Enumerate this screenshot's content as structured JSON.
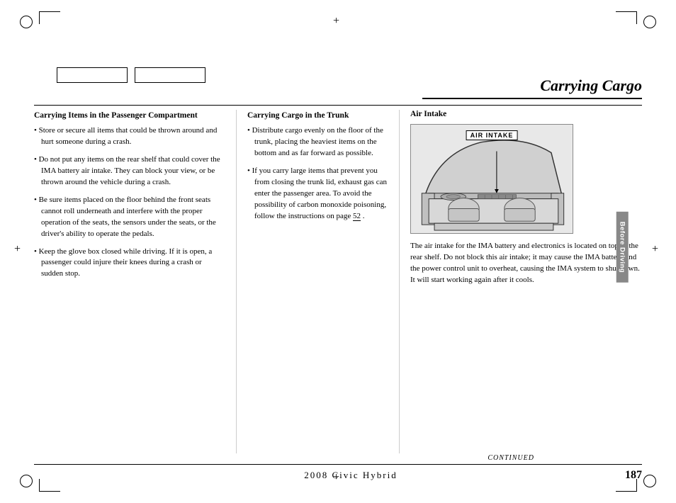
{
  "page": {
    "title": "Carrying Cargo",
    "footer_vehicle": "2008  Civic  Hybrid",
    "page_number": "187",
    "continued": "CONTINUED",
    "sidebar_label": "Before Driving"
  },
  "left_column": {
    "section_title": "Carrying Items in the Passenger Compartment",
    "bullets": [
      "Store or secure all items that could be thrown around and hurt someone during a crash.",
      "Do not put any items on the rear shelf that could cover the IMA battery air intake. They can block your view, or be thrown around the vehicle during a crash.",
      "Be sure items placed on the floor behind the front seats cannot roll underneath and interfere with the proper operation of the seats, the sensors under the seats, or the driver's ability to operate the pedals.",
      "Keep the glove box closed while driving. If it is open, a passenger could injure their knees during a crash or sudden stop."
    ]
  },
  "middle_column": {
    "section_title": "Carrying Cargo in the Trunk",
    "bullets": [
      "Distribute cargo evenly on the floor of the trunk, placing the heaviest items on the bottom and as far forward as possible.",
      "If you carry large items that prevent you from closing the trunk lid, exhaust gas can enter the passenger area. To avoid the possibility of carbon monoxide poisoning, follow the instructions on page 52 ."
    ],
    "page_link": "52"
  },
  "right_column": {
    "section_title": "Air Intake",
    "diagram_label": "AIR INTAKE",
    "description": "The air intake for the IMA battery and electronics is located on top of the rear shelf. Do not block this air intake; it may cause the IMA battery and the power control unit to overheat, causing the IMA system to shut down. It will start working again after it cools."
  }
}
